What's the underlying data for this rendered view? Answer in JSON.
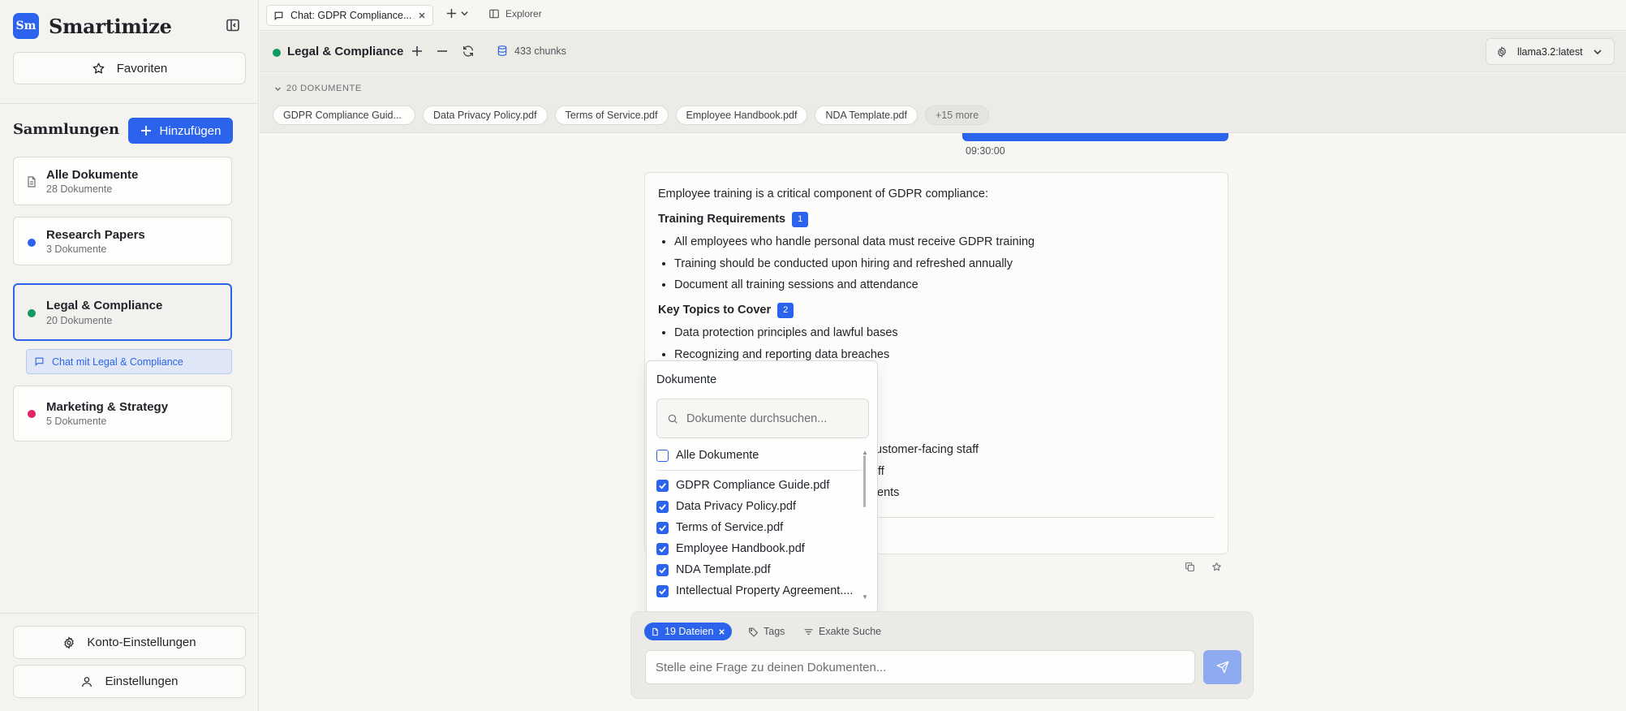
{
  "sidebar": {
    "brand_logo": "Sm",
    "brand_name": "Smartimize",
    "favorites_label": "Favoriten",
    "section_title": "Sammlungen",
    "add_label": "Hinzufügen",
    "collections": [
      {
        "name": "Alle Dokumente",
        "count": "28 Dokumente",
        "icon": "document-icon"
      },
      {
        "name": "Research Papers",
        "count": "3 Dokumente",
        "color": "#2b63ec"
      },
      {
        "name": "Legal & Compliance",
        "count": "20 Dokumente",
        "color": "#0f9a62"
      },
      {
        "name": "Marketing & Strategy",
        "count": "5 Dokumente",
        "color": "#e0256a"
      }
    ],
    "chat_with_label": "Chat mit Legal & Compliance",
    "account_settings_label": "Konto-Einstellungen",
    "settings_label": "Einstellungen"
  },
  "tabbar": {
    "tab_title": "Chat: GDPR Compliance...",
    "explorer_label": "Explorer"
  },
  "collection_bar": {
    "name": "Legal & Compliance",
    "chunks": "433 chunks",
    "model": "llama3.2:latest"
  },
  "documents_bar": {
    "label": "20 DOKUMENTE",
    "chips": [
      "GDPR Compliance Guid...",
      "Data Privacy Policy.pdf",
      "Terms of Service.pdf",
      "Employee Handbook.pdf",
      "NDA Template.pdf"
    ],
    "more": "+15 more"
  },
  "chat": {
    "user_time": "09:30:00",
    "answer": {
      "intro": "Employee training is a critical component of GDPR compliance:",
      "h1": "Training Requirements",
      "cite1": "1",
      "list1": [
        "All employees who handle personal data must receive GDPR training",
        "Training should be conducted upon hiring and refreshed annually",
        "Document all training sessions and attendance"
      ],
      "h2": "Key Topics to Cover",
      "cite2": "2",
      "list2": [
        "Data protection principles and lawful bases",
        "Recognizing and reporting data breaches"
      ],
      "tail1": "ustomer-facing staff",
      "tail2": "ff",
      "tail3": "ents"
    }
  },
  "popover": {
    "title": "Dokumente",
    "search_placeholder": "Dokumente durchsuchen...",
    "all_label": "Alle Dokumente",
    "items": [
      "GDPR Compliance Guide.pdf",
      "Data Privacy Policy.pdf",
      "Terms of Service.pdf",
      "Employee Handbook.pdf",
      "NDA Template.pdf",
      "Intellectual Property Agreement...."
    ]
  },
  "composer": {
    "files_pill": "19 Dateien",
    "tags_label": "Tags",
    "exact_search_label": "Exakte Suche",
    "placeholder": "Stelle eine Frage zu deinen Dokumenten..."
  }
}
